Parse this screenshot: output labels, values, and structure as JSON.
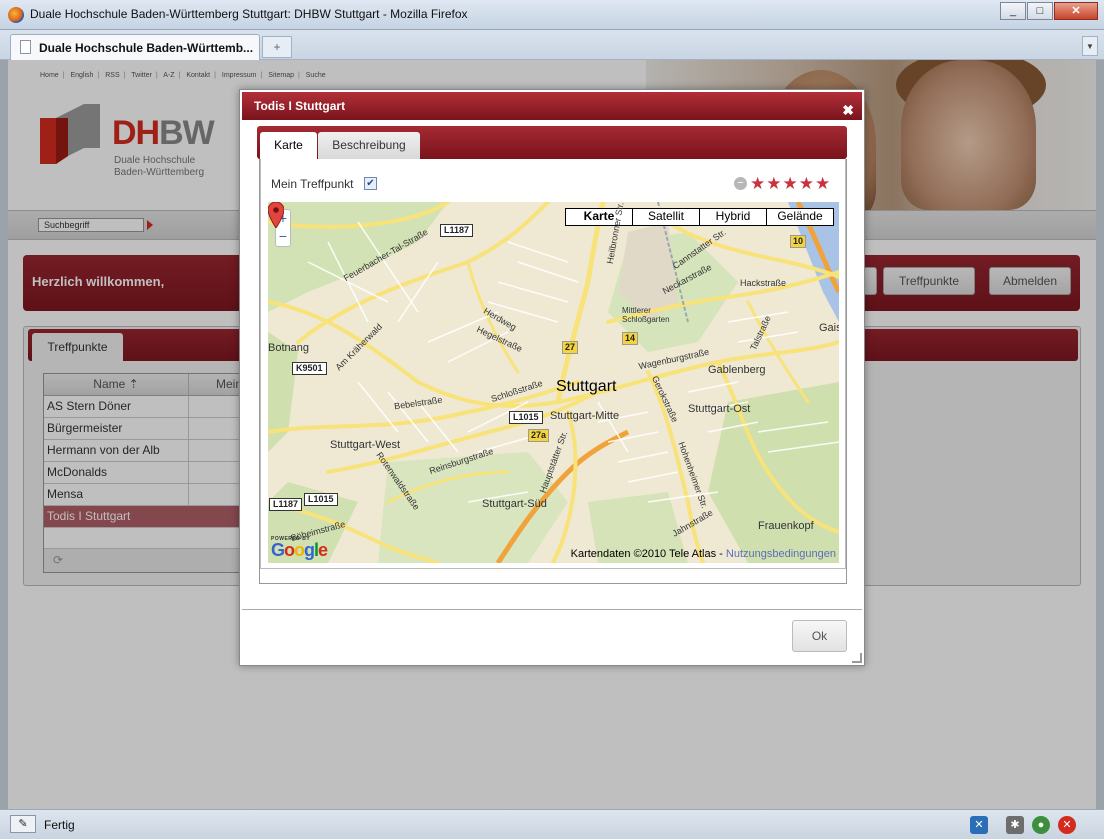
{
  "window": {
    "title": "Duale Hochschule Baden-Württemberg Stuttgart: DHBW Stuttgart - Mozilla Firefox",
    "tab_label": "Duale Hochschule Baden-Württemb...",
    "new_tab_glyph": "+",
    "minimize": "_",
    "maximize": "□",
    "close": "✕"
  },
  "site": {
    "nav": [
      "Home",
      "English",
      "RSS",
      "Twitter",
      "A-Z",
      "Kontakt",
      "Impressum",
      "Sitemap",
      "Suche"
    ],
    "logo": {
      "brand": "DH",
      "brand_b": "BW",
      "sub1": "Duale Hochschule",
      "sub2": "Baden-Württemberg",
      "accent": "#d52b1e"
    },
    "search_placeholder": "Suchbegriff",
    "welcome": "Herzlich willkommen,",
    "buttons": {
      "treffpunkte": "Treffpunkte",
      "abmelden": "Abmelden"
    },
    "panel_tab": "Treffpunkte",
    "grid": {
      "col_name": "Name",
      "col_desc": "Mein",
      "rows": [
        "AS Stern Döner",
        "Bürgermeister",
        "Hermann von der Alb",
        "McDonalds",
        "Mensa",
        "Todis I Stuttgart"
      ],
      "selected_index": 5
    }
  },
  "dialog": {
    "title": "Todis I Stuttgart",
    "close_glyph": "✖",
    "tabs": [
      "Karte",
      "Beschreibung"
    ],
    "active_tab": "Karte",
    "checkbox_label": "Mein Treffpunkt",
    "checkbox_checked": true,
    "rating": {
      "value": 5,
      "max": 5,
      "color": "#c9333f"
    },
    "ok_label": "Ok"
  },
  "map": {
    "types": [
      "Karte",
      "Satellit",
      "Hybrid",
      "Gelände"
    ],
    "selected_type": "Karte",
    "zoom_in": "+",
    "zoom_out": "−",
    "city": "Stuttgart",
    "districts": [
      "Stuttgart-Mitte",
      "Stuttgart-West",
      "Stuttgart-Ost",
      "Stuttgart-Süd",
      "Gablenberg",
      "Frauenkopf",
      "Botnang",
      "Gais",
      "Mittlerer Schloßgarten"
    ],
    "roads": [
      "Feuerbacher-Tal-Straße",
      "Am Kräherwald",
      "Herdweg",
      "Hegelstraße",
      "Schloßstraße",
      "Bebelstraße",
      "Reinsburgstraße",
      "Rotenwaldstraße",
      "Böheimstraße",
      "Hauptstätter Str.",
      "Wagenburgstraße",
      "Gerokstraße",
      "Hackstraße",
      "Cannstatter Str.",
      "Neckarstraße",
      "Talstraße",
      "Jahnstraße",
      "Hohenheimer Str.",
      "Heilbronner Str."
    ],
    "shields": [
      "L1187",
      "K9501",
      "L1015",
      "L1187",
      "L1015"
    ],
    "yellow_shields": [
      "27",
      "14",
      "27a",
      "10"
    ],
    "powered_by": "POWERED BY",
    "google": [
      "G",
      "o",
      "o",
      "g",
      "l",
      "e"
    ],
    "credit": "Kartendaten ©2010 Tele Atlas - ",
    "credit_link": "Nutzungsbedingungen"
  },
  "status": {
    "text": "Fertig"
  }
}
